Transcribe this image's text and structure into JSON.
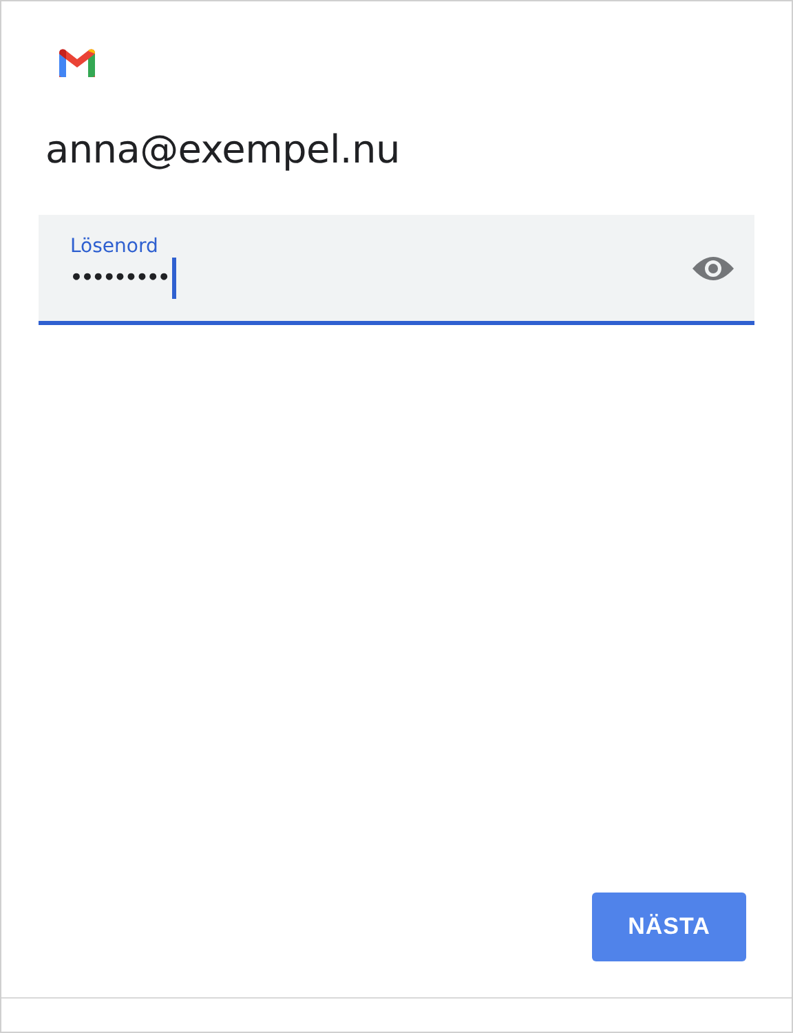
{
  "account": {
    "email": "anna@exempel.nu"
  },
  "password_field": {
    "label": "Lösenord",
    "value": "•••••••••",
    "focused": true
  },
  "buttons": {
    "next": "NÄSTA"
  }
}
